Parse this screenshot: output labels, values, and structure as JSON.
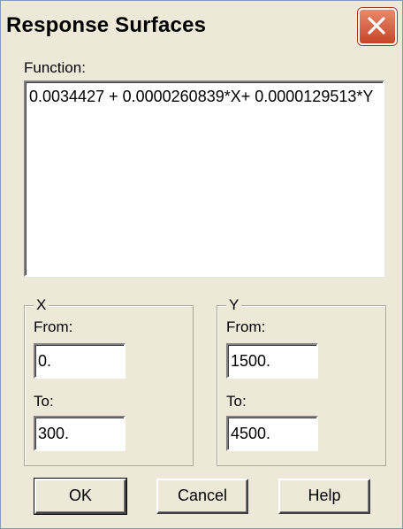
{
  "window": {
    "title": "Response Surfaces"
  },
  "function": {
    "label": "Function:",
    "value": "0.0034427 + 0.0000260839*X+ 0.0000129513*Y"
  },
  "x_group": {
    "legend": "X",
    "from_label": "From:",
    "from_value": "0.",
    "to_label": "To:",
    "to_value": "300."
  },
  "y_group": {
    "legend": "Y",
    "from_label": "From:",
    "from_value": "1500.",
    "to_label": "To:",
    "to_value": "4500."
  },
  "buttons": {
    "ok": "OK",
    "cancel": "Cancel",
    "help": "Help"
  },
  "colors": {
    "dialog_bg": "#ece9d8",
    "close_button": "#c8452a"
  }
}
